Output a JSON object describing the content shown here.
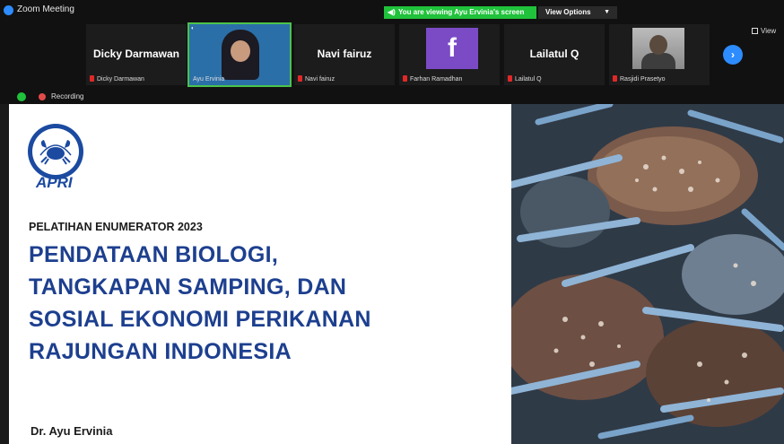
{
  "window": {
    "title": "Zoom Meeting"
  },
  "banner": {
    "viewing_text": "You are viewing Ayu Ervinia's screen",
    "view_options_label": "View Options",
    "view_label": "View"
  },
  "participants": [
    {
      "display": "Dicky Darmawan",
      "caption": "Dicky Darmawan",
      "muted": true,
      "kind": "name"
    },
    {
      "display": "",
      "caption": "Ayu Ervinia",
      "muted": false,
      "kind": "video"
    },
    {
      "display": "Navi fairuz",
      "caption": "Navi fairuz",
      "muted": true,
      "kind": "name"
    },
    {
      "display": "f",
      "caption": "Farhan Ramadhan",
      "muted": true,
      "kind": "avatar-letter",
      "avatar_color": "#7b4bc6"
    },
    {
      "display": "Lailatul Q",
      "caption": "Lailatul Q",
      "muted": true,
      "kind": "name"
    },
    {
      "display": "",
      "caption": "Rasjidi Prasetyo",
      "muted": true,
      "kind": "photo"
    }
  ],
  "status": {
    "recording_label": "Recording"
  },
  "slide": {
    "logo_text": "APRI",
    "subtitle": "PELATIHAN ENUMERATOR 2023",
    "title_lines": [
      "PENDATAAN BIOLOGI,",
      "TANGKAPAN SAMPING, DAN",
      "SOSIAL EKONOMI PERIKANAN",
      "RAJUNGAN INDONESIA"
    ],
    "author": "Dr. Ayu Ervinia"
  },
  "colors": {
    "accent_blue": "#1d3f8f",
    "zoom_blue": "#2d8cff",
    "banner_green": "#20c23b",
    "muted_red": "#e02828"
  }
}
